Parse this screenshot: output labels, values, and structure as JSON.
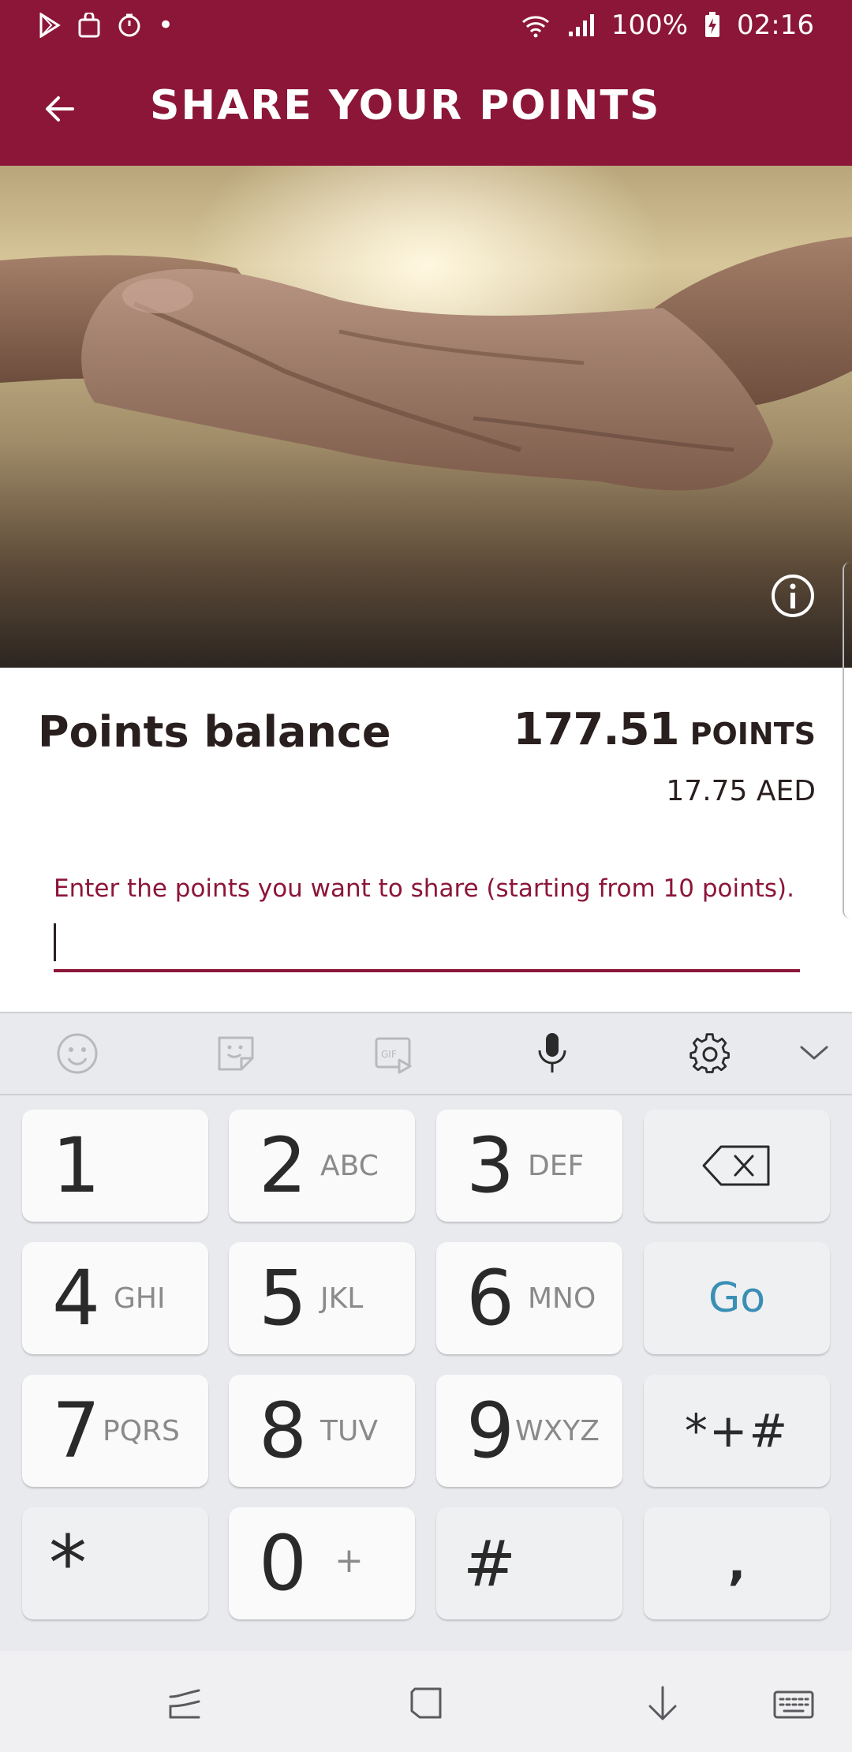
{
  "status_bar": {
    "battery": "100%",
    "time": "02:16",
    "dot": "•"
  },
  "app_bar": {
    "title": "SHARE YOUR POINTS"
  },
  "balance": {
    "title": "Points balance",
    "points_value": "177.51",
    "points_unit": "POINTS",
    "aed_value": "17.75 AED"
  },
  "share_input": {
    "label": "Enter the points you want to share (starting from 10 points).",
    "value": ""
  },
  "keyboard": {
    "toolbar_icons": [
      "emoji-icon",
      "sticker-icon",
      "gif-icon",
      "microphone-icon",
      "gear-icon",
      "chevron-down-icon"
    ],
    "keys": {
      "k1": {
        "digit": "1",
        "letters": ""
      },
      "k2": {
        "digit": "2",
        "letters": "ABC"
      },
      "k3": {
        "digit": "3",
        "letters": "DEF"
      },
      "k4": {
        "digit": "4",
        "letters": "GHI"
      },
      "k5": {
        "digit": "5",
        "letters": "JKL"
      },
      "k6": {
        "digit": "6",
        "letters": "MNO"
      },
      "k7": {
        "digit": "7",
        "letters": "PQRS"
      },
      "k8": {
        "digit": "8",
        "letters": "TUV"
      },
      "k9": {
        "digit": "9",
        "letters": "WXYZ"
      },
      "k0": {
        "digit": "0",
        "letters": "+"
      },
      "star": "*",
      "hash": "#",
      "go": "Go",
      "symbols": "*+#",
      "comma": ","
    },
    "colors": {
      "go": "#3a8fb5"
    }
  },
  "theme": {
    "primary": "#8c1638"
  }
}
